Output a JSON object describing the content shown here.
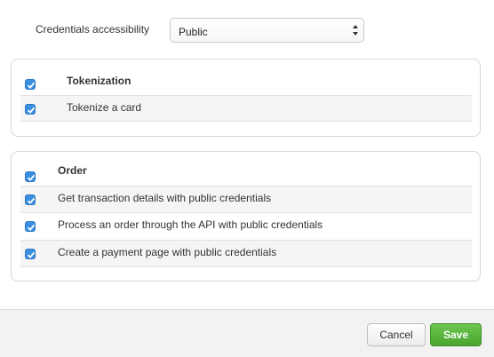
{
  "access": {
    "label": "Credentials accessibility",
    "selected": "Public",
    "arrow_icon": "up-down-chevron-icon"
  },
  "sections": [
    {
      "header": "Tokenization",
      "header_checked": true,
      "items": [
        {
          "label": "Tokenize a card",
          "checked": true
        }
      ]
    },
    {
      "header": "Order",
      "header_checked": true,
      "items": [
        {
          "label": "Get transaction details with public credentials",
          "checked": true
        },
        {
          "label": "Process an order through the API with public credentials",
          "checked": true
        },
        {
          "label": "Create a payment page with public credentials",
          "checked": true
        }
      ]
    }
  ],
  "footer": {
    "cancel_label": "Cancel",
    "save_label": "Save"
  },
  "colors": {
    "checkbox_blue": "#3b8fe0",
    "save_green": "#4aa52f"
  }
}
